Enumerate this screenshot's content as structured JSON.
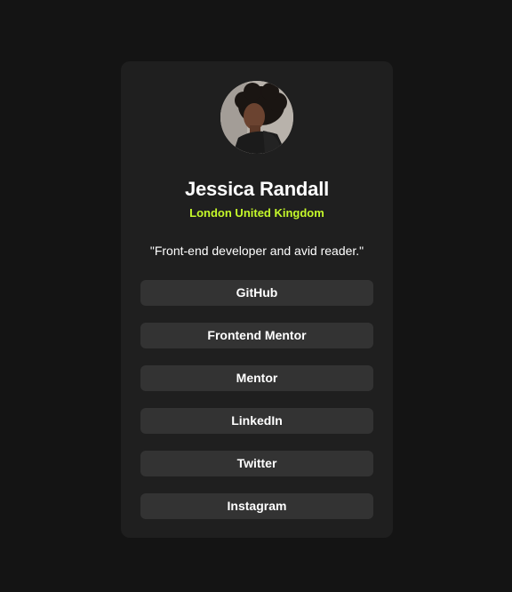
{
  "profile": {
    "name": "Jessica Randall",
    "location": "London United Kingdom",
    "bio": "\"Front-end developer and avid reader.\"",
    "avatar_icon": "profile-photo"
  },
  "links": [
    {
      "label": "GitHub"
    },
    {
      "label": "Frontend Mentor"
    },
    {
      "label": "Mentor"
    },
    {
      "label": "LinkedIn"
    },
    {
      "label": "Twitter"
    },
    {
      "label": "Instagram"
    }
  ],
  "colors": {
    "page_background": "#141414",
    "card_background": "#1f1f1f",
    "button_background": "#333333",
    "accent": "#c4f82a",
    "text": "#ffffff"
  }
}
